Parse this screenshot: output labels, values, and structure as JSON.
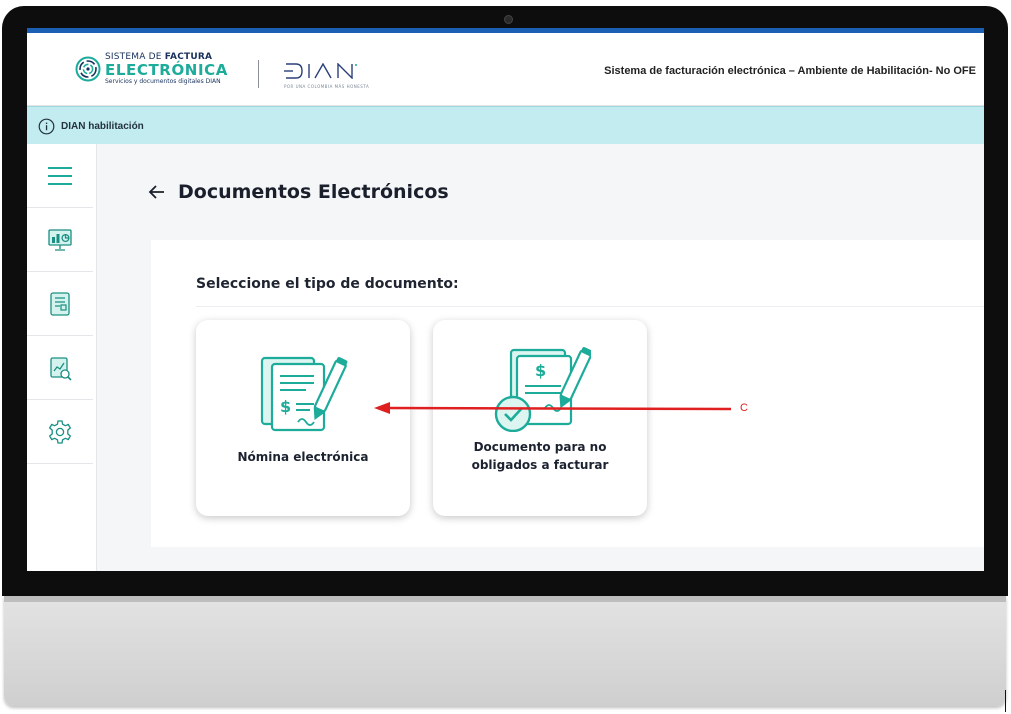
{
  "header": {
    "logo_line1_prefix": "SISTEMA DE",
    "logo_line1_bold": "FACTURA",
    "logo_line2": "ELECTRÓNICA",
    "logo_line3": "Servicios y documentos digitales DIAN",
    "partner_logo": "DIAN",
    "partner_tagline": "POR UNA COLOMBIA MÁS HONESTA",
    "title": "Sistema de facturación electrónica – Ambiente de Habilitación- No OFE"
  },
  "infobar": {
    "icon": "info-circle-icon",
    "text": "DIAN habilitación"
  },
  "sidebar": {
    "items": [
      {
        "icon": "hamburger-menu-icon"
      },
      {
        "icon": "dashboard-monitor-icon"
      },
      {
        "icon": "document-list-icon"
      },
      {
        "icon": "report-chart-icon"
      },
      {
        "icon": "gear-icon"
      }
    ]
  },
  "main": {
    "back_icon": "arrow-left-icon",
    "title": "Documentos Electrónicos",
    "section_title": "Seleccione el tipo de documento:",
    "cards": [
      {
        "label": "Nómina electrónica",
        "icon": "payroll-document-icon"
      },
      {
        "label_line1": "Documento para no",
        "label_line2": "obligados a facturar",
        "icon": "document-check-icon"
      }
    ]
  },
  "annotation": {
    "color": "#e02020",
    "text": "C"
  },
  "colors": {
    "brand_teal": "#1dab9a",
    "brand_navy": "#18315c",
    "top_bar": "#1a5fb4",
    "info_bar": "#c3ecf0"
  }
}
